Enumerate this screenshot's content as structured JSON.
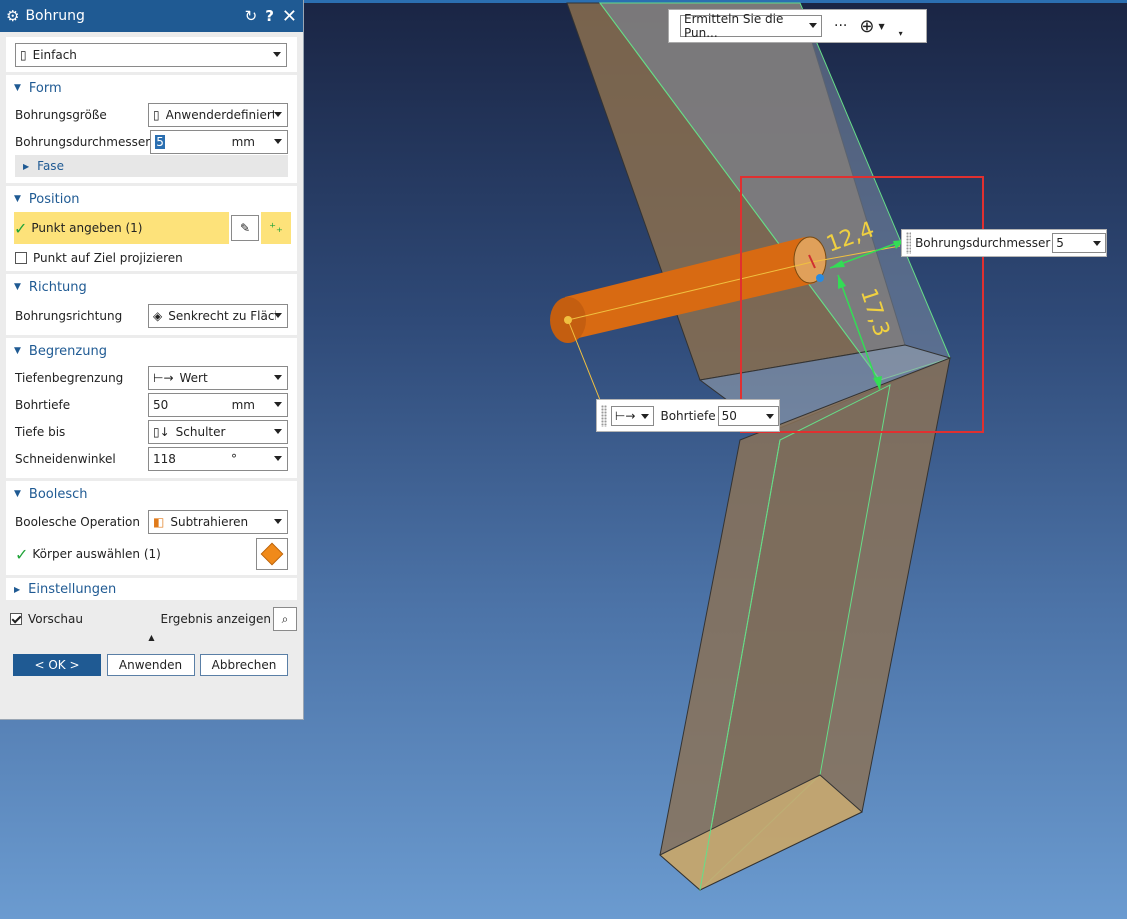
{
  "dialog": {
    "title": "Bohrung",
    "type_value": "Einfach",
    "sections": {
      "form": {
        "title": "Form",
        "size_label": "Bohrungsgröße",
        "size_value": "Anwenderdefiniert",
        "diameter_label": "Bohrungsdurchmesser",
        "diameter_value": "5",
        "diameter_unit": "mm",
        "fase_label": "Fase"
      },
      "position": {
        "title": "Position",
        "point_label": "Punkt angeben (1)",
        "project_label": "Punkt auf Ziel projizieren"
      },
      "richtung": {
        "title": "Richtung",
        "dir_label": "Bohrungsrichtung",
        "dir_value": "Senkrecht zu Fläch"
      },
      "begrenzung": {
        "title": "Begrenzung",
        "depth_limit_label": "Tiefenbegrenzung",
        "depth_limit_value": "Wert",
        "depth_label": "Bohrtiefe",
        "depth_value": "50",
        "depth_unit": "mm",
        "depth_to_label": "Tiefe bis",
        "depth_to_value": "Schulter",
        "angle_label": "Schneidenwinkel",
        "angle_value": "118",
        "angle_unit": "°"
      },
      "boolesch": {
        "title": "Boolesch",
        "op_label": "Boolesche Operation",
        "op_value": "Subtrahieren",
        "body_label": "Körper auswählen (1)"
      },
      "einstellungen": {
        "title": "Einstellungen"
      }
    },
    "preview_label": "Vorschau",
    "result_label": "Ergebnis anzeigen",
    "buttons": {
      "ok": "< OK >",
      "apply": "Anwenden",
      "cancel": "Abbrechen"
    }
  },
  "toolbar": {
    "point_mode_value": "Ermitteln Sie die Pun..."
  },
  "viewport": {
    "dim_top": "12,4",
    "dim_side": "17,3",
    "diameter_box_label": "Bohrungsdurchmesser",
    "diameter_box_value": "5",
    "depth_box_label": "Bohrtiefe",
    "depth_box_value": "50"
  }
}
